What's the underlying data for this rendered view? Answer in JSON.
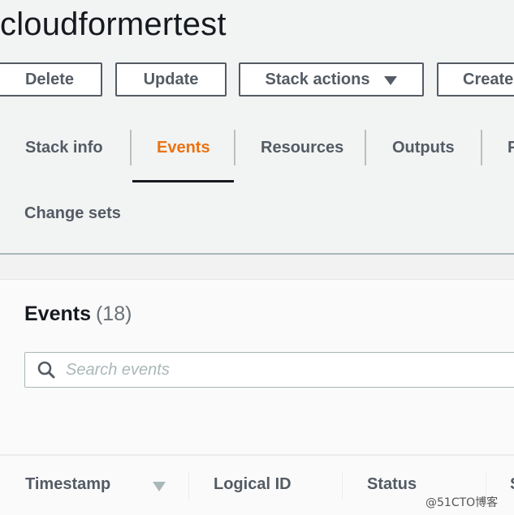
{
  "header": {
    "title": "cloudformertest"
  },
  "actions": {
    "delete_label": "Delete",
    "update_label": "Update",
    "stack_actions_label": "Stack actions",
    "create_label": "Create"
  },
  "tabs": [
    {
      "label": "Stack info",
      "active": false
    },
    {
      "label": "Events",
      "active": true
    },
    {
      "label": "Resources",
      "active": false
    },
    {
      "label": "Outputs",
      "active": false
    },
    {
      "label": "P",
      "active": false
    },
    {
      "label": "Change sets",
      "active": false
    }
  ],
  "events": {
    "heading": "Events",
    "count": "(18)",
    "search": {
      "placeholder": "Search events",
      "value": ""
    },
    "columns": [
      {
        "label": "Timestamp",
        "sorted": "descending"
      },
      {
        "label": "Logical ID"
      },
      {
        "label": "Status"
      },
      {
        "label": "S"
      }
    ]
  },
  "colors": {
    "active_tab": "#ec7211",
    "text_primary": "#16191f",
    "text_secondary": "#545b64",
    "border": "#aab7b8"
  },
  "watermark": "@51CTO博客"
}
